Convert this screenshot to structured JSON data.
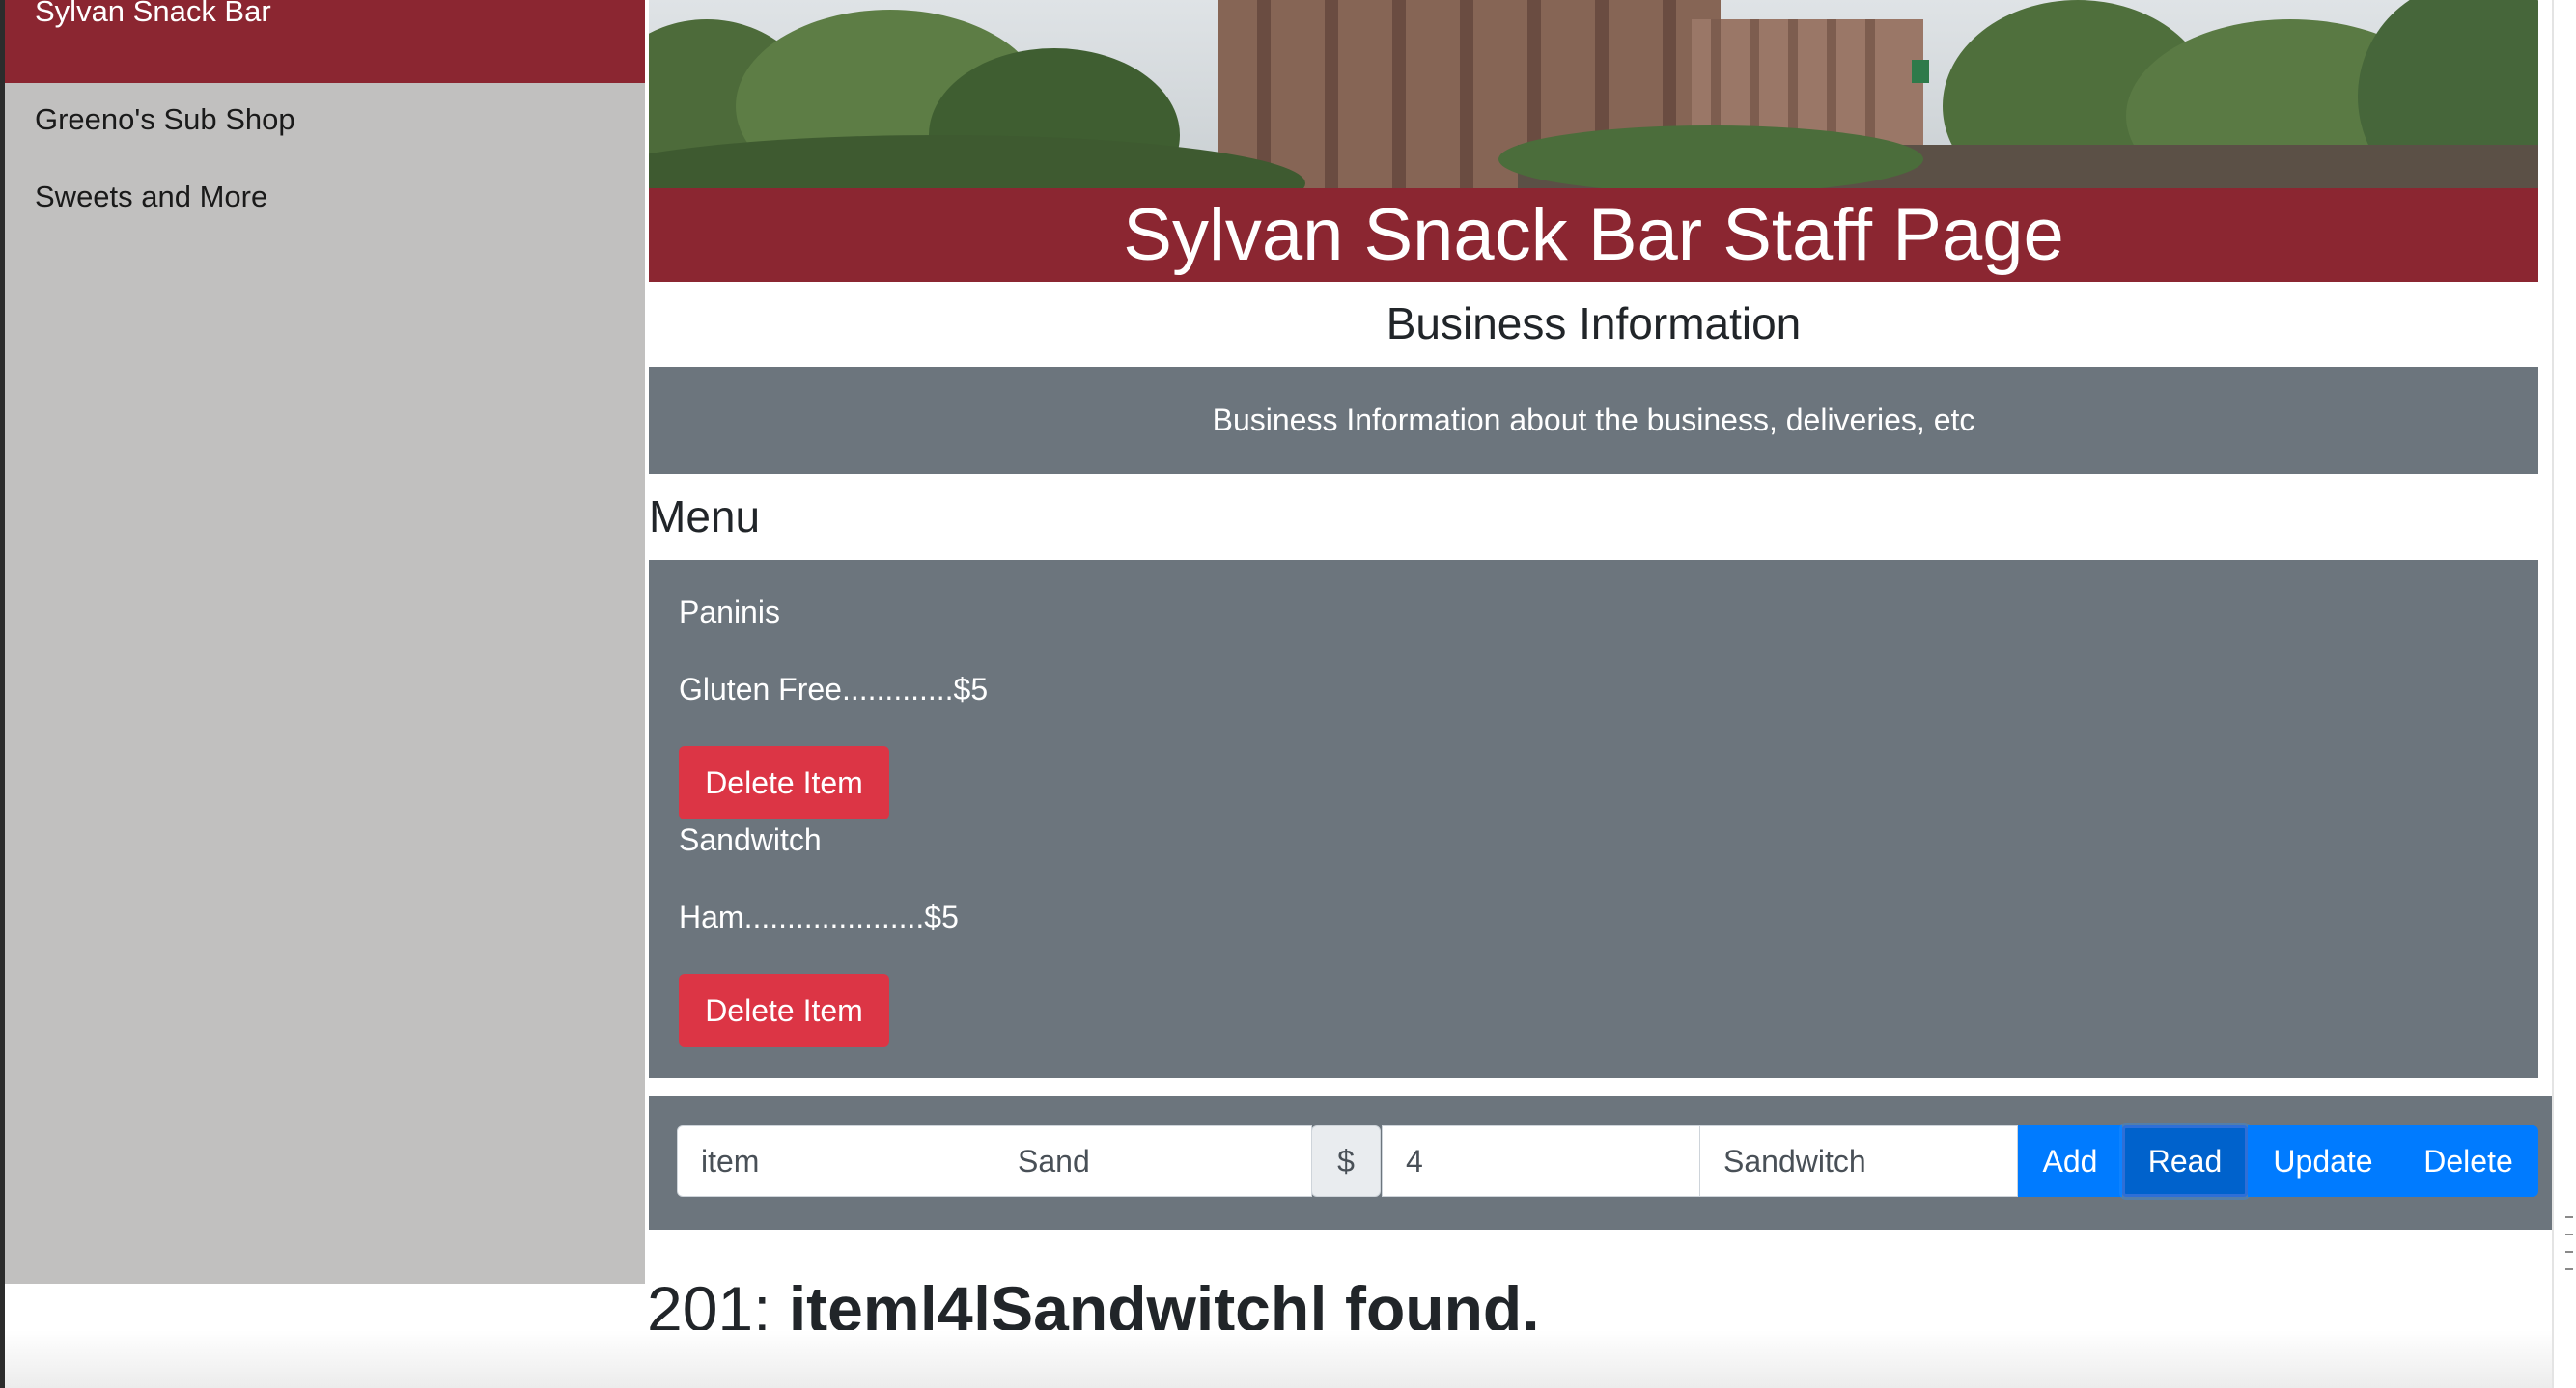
{
  "sidebar": {
    "active_item": "Sylvan Snack Bar",
    "items": [
      {
        "label": "Greeno's Sub Shop"
      },
      {
        "label": "Sweets and More"
      }
    ]
  },
  "header": {
    "title": "Sylvan Snack Bar Staff Page"
  },
  "business": {
    "heading": "Business Information",
    "text": "Business Information about the business, deliveries, etc"
  },
  "menu": {
    "heading": "Menu",
    "sections": [
      {
        "category": "Paninis",
        "item": "Gluten Free.............$5",
        "delete_label": "Delete Item"
      },
      {
        "category": "Sandwitch",
        "item": "Ham.....................$5",
        "delete_label": "Delete Item"
      }
    ]
  },
  "form": {
    "field1_value": "item",
    "field2_value": "Sand",
    "currency_symbol": "$",
    "price_value": "4",
    "category_value": "Sandwitch",
    "buttons": {
      "add": "Add",
      "read": "Read",
      "update": "Update",
      "delete": "Delete"
    },
    "active_button": "Read"
  },
  "status": {
    "code": "201:",
    "message": "item|4|Sandwitch| found."
  },
  "colors": {
    "brand": "#8b2631",
    "panel": "#6c757d",
    "sidebar": "#c1c0bf",
    "danger": "#dc3545",
    "primary": "#007bff"
  }
}
